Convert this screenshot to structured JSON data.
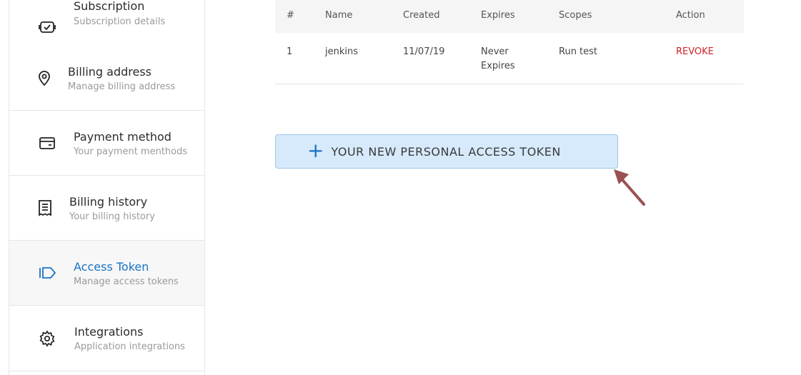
{
  "sidebar": {
    "items": [
      {
        "title": "Subscription",
        "subtitle": "Subscription details",
        "icon": "subscription-icon"
      },
      {
        "title": "Billing address",
        "subtitle": "Manage billing address",
        "icon": "location-pin-icon"
      },
      {
        "title": "Payment method",
        "subtitle": "Your payment menthods",
        "icon": "credit-card-icon"
      },
      {
        "title": "Billing history",
        "subtitle": "Your billing history",
        "icon": "receipt-icon"
      },
      {
        "title": "Access Token",
        "subtitle": "Manage access tokens",
        "icon": "token-tag-icon",
        "active": true
      },
      {
        "title": "Integrations",
        "subtitle": "Application integrations",
        "icon": "integrations-gear-icon"
      }
    ]
  },
  "table": {
    "headers": [
      "#",
      "Name",
      "Created",
      "Expires",
      "Scopes",
      "Action"
    ],
    "rows": [
      {
        "index": "1",
        "name": "jenkins",
        "created": "11/07/19",
        "expires_line1": "Never",
        "expires_line2": "Expires",
        "scopes": "Run test",
        "action": "REVOKE"
      }
    ]
  },
  "new_token_button": {
    "icon": "plus-icon",
    "label": "YOUR NEW PERSONAL ACCESS TOKEN"
  },
  "colors": {
    "accent": "#1a73c7",
    "revoke": "#d0212a",
    "button_bg": "#d6eafb",
    "arrow": "#9a5152"
  }
}
